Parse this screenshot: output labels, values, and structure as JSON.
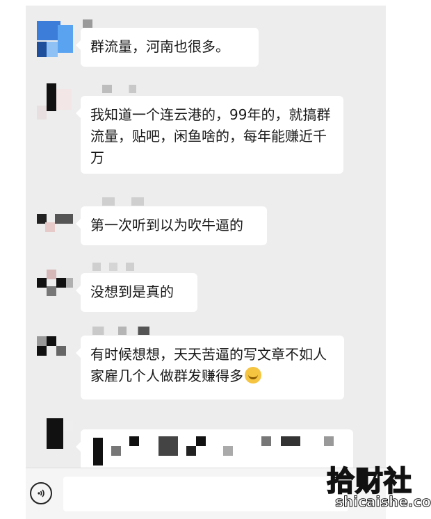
{
  "messages": [
    {
      "text": "群流量，河南也很多。"
    },
    {
      "text": "我知道一个连云港的，99年的，就搞群流量，贴吧，闲鱼啥的，每年能赚近千万"
    },
    {
      "text": "第一次听到以为吹牛逼的"
    },
    {
      "text": "没想到是真的"
    },
    {
      "text": "有时候想想，天天苦逼的写文章不如人家雇几个人做群发赚得多",
      "emoji": "laugh-cry-emoji"
    }
  ],
  "watermark": {
    "main": "拾财社",
    "sub": "shicaishe.com"
  },
  "icons": {
    "voice": "voice-icon",
    "emoji": "laugh-cry-emoji"
  }
}
